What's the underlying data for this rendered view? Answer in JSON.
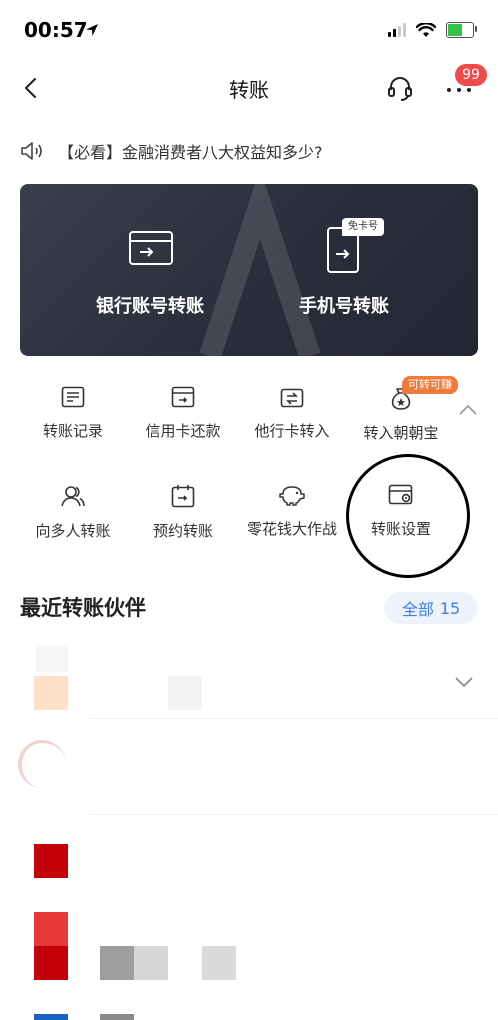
{
  "status_bar": {
    "time": "00:57"
  },
  "nav": {
    "title": "转账",
    "more_badge": "99"
  },
  "notice": {
    "text": "【必看】金融消费者八大权益知多少?"
  },
  "banner": {
    "bank_transfer_label": "银行账号转账",
    "phone_transfer_label": "手机号转账",
    "free_card_tag": "免卡号"
  },
  "functions": {
    "row1": [
      {
        "label": "转账记录",
        "icon": "list-icon"
      },
      {
        "label": "信用卡还款",
        "icon": "card-repay-icon"
      },
      {
        "label": "他行卡转入",
        "icon": "card-transfer-in-icon"
      },
      {
        "label": "转入朝朝宝",
        "icon": "money-bag-icon"
      }
    ],
    "row2": [
      {
        "label": "向多人转账",
        "icon": "multi-user-icon"
      },
      {
        "label": "预约转账",
        "icon": "calendar-icon"
      },
      {
        "label": "零花钱大作战",
        "icon": "piggy-bank-icon"
      },
      {
        "label": "转账设置",
        "icon": "card-settings-icon"
      }
    ],
    "earn_tag": "可转可赚"
  },
  "recent": {
    "title": "最近转账伙伴",
    "all_label": "全部",
    "all_count": "15"
  },
  "colors": {
    "accent_blue": "#3a80e8",
    "badge_red": "#f04a4a",
    "tag_orange": "#f07a3c",
    "banner_dark": "#2a2e3a"
  }
}
